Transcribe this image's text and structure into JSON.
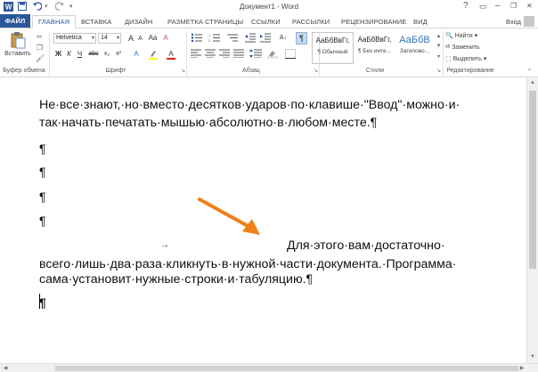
{
  "titlebar": {
    "title": "Документ1 - Word",
    "help": "?",
    "minimize": "–",
    "restore": "❐",
    "close": "✕",
    "save_icon": "save-icon",
    "undo_icon": "undo-icon",
    "redo_icon": "redo-icon",
    "customize_icon": "customize-icon"
  },
  "tabs": {
    "file": "ФАЙЛ",
    "items": [
      "ГЛАВНАЯ",
      "ВСТАВКА",
      "ДИЗАЙН",
      "РАЗМЕТКА СТРАНИЦЫ",
      "ССЫЛКИ",
      "РАССЫЛКИ",
      "РЕЦЕНЗИРОВАНИЕ",
      "ВИД"
    ],
    "login": "Вход"
  },
  "ribbon": {
    "clipboard": {
      "paste_label": "Вставить",
      "group_label": "Буфер обмена"
    },
    "font": {
      "font_name": "Helvetica",
      "font_size": "14",
      "bold": "Ж",
      "italic": "К",
      "underline": "Ч",
      "strike": "abc",
      "subscript": "x₂",
      "superscript": "x²",
      "grow": "A",
      "shrink": "A",
      "case": "Aa",
      "clear": "A",
      "group_label": "Шрифт"
    },
    "paragraph": {
      "group_label": "Абзац",
      "show_marks": "¶"
    },
    "styles": {
      "items": [
        {
          "sample": "АаБбВвГг,",
          "name": "¶ Обычный"
        },
        {
          "sample": "АаБбВвГг,",
          "name": "¶ Без инте..."
        },
        {
          "sample": "АаБбВ",
          "name": "Заголово..."
        }
      ],
      "group_label": "Стили"
    },
    "editing": {
      "find": "Найти",
      "replace": "Заменить",
      "select": "Выделить",
      "group_label": "Редактирование"
    }
  },
  "document": {
    "line1": "Не·все·знают,·но·вместо·десятков·ударов·по·клавише·\"Ввод\"·можно·и·",
    "line2": "так·начать·печатать·мышью·абсолютно·в·любом·месте.¶",
    "pilcrow": "¶",
    "tab_arrow": "→",
    "line3": "Для·этого·вам·достаточно·",
    "line4": "всего·лишь·два·раза·кликнуть·в·нужной·части·документа.·Программа·",
    "line5": "сама·установит·нужные·строки·и·табуляцию.¶"
  },
  "colors": {
    "accent": "#2b579a",
    "arrow": "#f07f19"
  }
}
